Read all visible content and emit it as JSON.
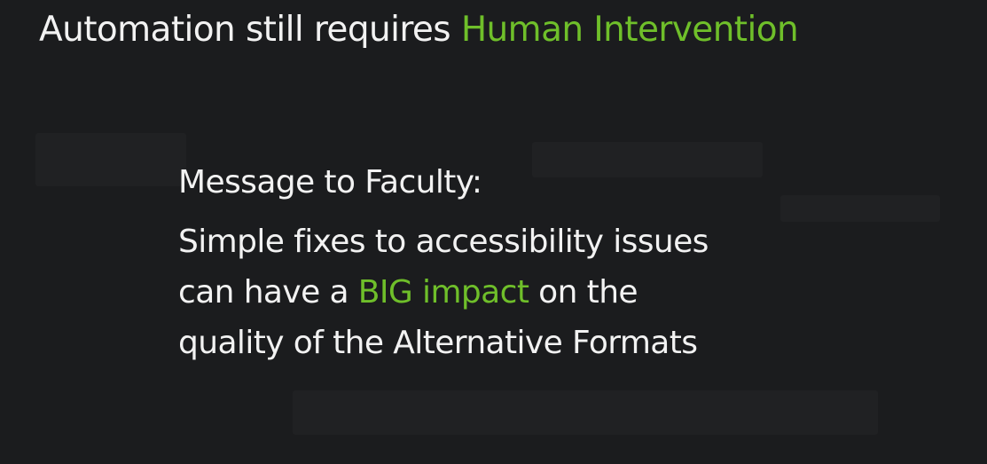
{
  "slide": {
    "title_prefix": "Automation still requires ",
    "title_highlight": "Human Intervention",
    "message_heading": "Message to Faculty:",
    "line1": "Simple fixes to accessibility issues",
    "line2_prefix": "can have a ",
    "line2_highlight": "BIG impact",
    "line2_suffix": " on the",
    "line3": "quality of the Alternative Formats"
  },
  "colors": {
    "background": "#1b1c1e",
    "text": "#f2f2f2",
    "accent": "#6fbf2a"
  }
}
